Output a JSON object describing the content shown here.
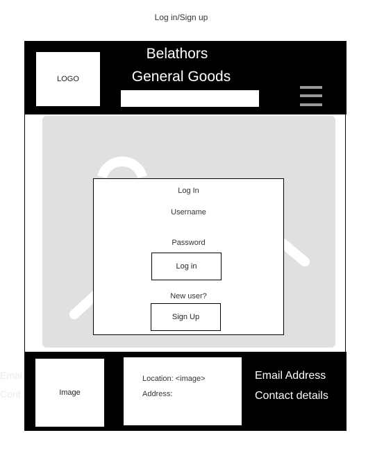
{
  "page": {
    "title": "Log in/Sign up"
  },
  "header": {
    "logo_label": "LOGO",
    "brand_line1": "Belathors",
    "brand_line2": "General Goods",
    "search_value": ""
  },
  "login": {
    "heading": "Log In",
    "username_label": "Username",
    "password_label": "Password",
    "login_button": "Log in",
    "new_user_text": "New user?",
    "signup_button": "Sign Up"
  },
  "footer": {
    "image_label": "Image",
    "location_text": "Location: <image>",
    "address_text": "Address:",
    "email_text": "Email Address",
    "contact_text": "Contact details",
    "ghost_email": "Emai",
    "ghost_contact": "Cont"
  },
  "colors": {
    "header_bg": "#000000",
    "hero_bg": "#e0e0e0",
    "menu_icon": "#9a9a9a"
  },
  "icons": {
    "menu": "hamburger-icon",
    "hero": "image-placeholder-icon"
  }
}
